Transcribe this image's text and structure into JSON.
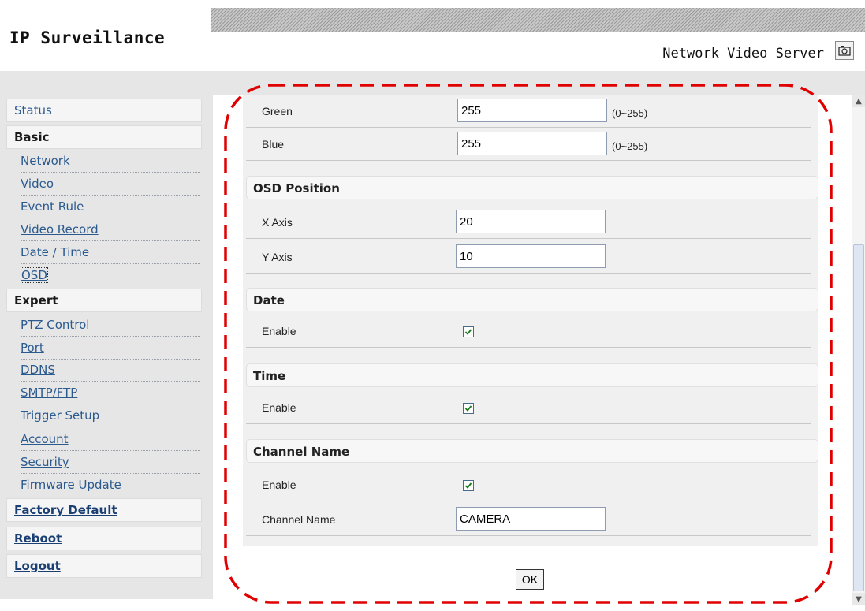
{
  "header": {
    "brand": "IP Surveillance",
    "server_title": "Network Video Server",
    "camera_icon": "camera-icon"
  },
  "sidebar": {
    "status": "Status",
    "basic": "Basic",
    "basic_items": [
      "Network",
      "Video",
      "Event Rule",
      "Video Record",
      "Date / Time",
      "OSD"
    ],
    "expert": "Expert",
    "expert_items": [
      "PTZ Control",
      "Port",
      "DDNS",
      "SMTP/FTP",
      "Trigger Setup",
      "Account",
      "Security",
      "Firmware Update"
    ],
    "factory_default": "Factory Default",
    "reboot": "Reboot",
    "logout": "Logout"
  },
  "form": {
    "green": {
      "label": "Green",
      "value": "255",
      "range": "(0~255)"
    },
    "blue": {
      "label": "Blue",
      "value": "255",
      "range": "(0~255)"
    },
    "osd_position": {
      "title": "OSD Position",
      "x_label": "X Axis",
      "x_value": "20",
      "y_label": "Y Axis",
      "y_value": "10"
    },
    "date": {
      "title": "Date",
      "enable_label": "Enable",
      "enabled": true
    },
    "time": {
      "title": "Time",
      "enable_label": "Enable",
      "enabled": true
    },
    "channel_name": {
      "title": "Channel Name",
      "enable_label": "Enable",
      "enabled": true,
      "name_label": "Channel Name",
      "name_value": "CAMERA"
    },
    "ok_label": "OK"
  },
  "colors": {
    "link": "#2b5a8f",
    "highlight_dash": "#e00000",
    "panel_bg": "#f0f0f0",
    "sidebar_bg": "#e6e6e6"
  }
}
